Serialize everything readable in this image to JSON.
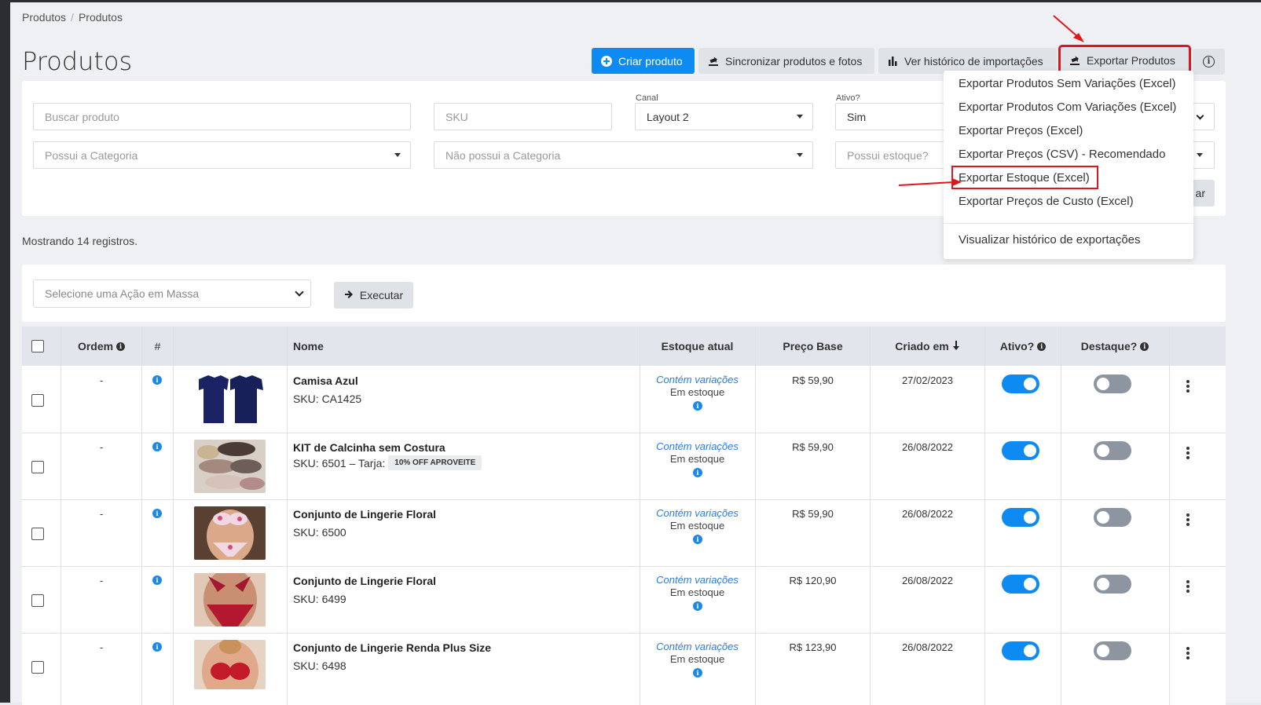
{
  "breadcrumb": [
    "Produtos",
    "Produtos"
  ],
  "page_title": "Produtos",
  "toolbar": {
    "create": "Criar produto",
    "sync": "Sincronizar produtos e fotos",
    "history": "Ver histórico de importações",
    "export": "Exportar Produtos"
  },
  "filters": {
    "search_placeholder": "Buscar produto",
    "sku_placeholder": "SKU",
    "canal_label": "Canal",
    "canal_value": "Layout 2",
    "ativo_label": "Ativo?",
    "ativo_value": "Sim",
    "has_category_placeholder": "Possui a Categoria",
    "not_category_placeholder": "Não possui a Categoria",
    "has_stock_placeholder": "Possui estoque?",
    "hidden_button_fragment": "ar"
  },
  "export_menu": {
    "items": [
      "Exportar Produtos Sem Variações (Excel)",
      "Exportar Produtos Com Variações (Excel)",
      "Exportar Preços (Excel)",
      "Exportar Preços (CSV) - Recomendado",
      "Exportar Estoque (Excel)",
      "Exportar Preços de Custo (Excel)"
    ],
    "history": "Visualizar histórico de exportações"
  },
  "count_text": "Mostrando 14 registros.",
  "bulk": {
    "placeholder": "Selecione uma Ação em Massa",
    "execute": "Executar"
  },
  "table": {
    "headers": {
      "order": "Ordem",
      "hash": "#",
      "name": "Nome",
      "stock": "Estoque atual",
      "price": "Preço Base",
      "created": "Criado em",
      "active": "Ativo?",
      "featured": "Destaque?"
    },
    "rows": [
      {
        "order": "-",
        "name": "Camisa Azul",
        "sku": "SKU: CA1425",
        "badge": "",
        "stock_var": "Contém variações",
        "stock_status": "Em estoque",
        "price": "R$ 59,90",
        "created": "27/02/2023",
        "active": true,
        "featured": false
      },
      {
        "order": "-",
        "name": "KIT de Calcinha sem Costura",
        "sku": "SKU: 6501 – Tarja:",
        "badge": "10% OFF APROVEITE",
        "stock_var": "Contém variações",
        "stock_status": "Em estoque",
        "price": "R$ 59,90",
        "created": "26/08/2022",
        "active": true,
        "featured": false
      },
      {
        "order": "-",
        "name": "Conjunto de Lingerie Floral",
        "sku": "SKU: 6500",
        "badge": "",
        "stock_var": "Contém variações",
        "stock_status": "Em estoque",
        "price": "R$ 59,90",
        "created": "26/08/2022",
        "active": true,
        "featured": false
      },
      {
        "order": "-",
        "name": "Conjunto de Lingerie Floral",
        "sku": "SKU: 6499",
        "badge": "",
        "stock_var": "Contém variações",
        "stock_status": "Em estoque",
        "price": "R$ 120,90",
        "created": "26/08/2022",
        "active": true,
        "featured": false
      },
      {
        "order": "-",
        "name": "Conjunto de Lingerie Renda Plus Size",
        "sku": "SKU: 6498",
        "badge": "",
        "stock_var": "Contém variações",
        "stock_status": "Em estoque",
        "price": "R$ 123,90",
        "created": "26/08/2022",
        "active": true,
        "featured": false
      }
    ]
  },
  "colors": {
    "primary": "#0d8bf2",
    "highlight": "#e3141b",
    "link": "#2a7ae4"
  }
}
